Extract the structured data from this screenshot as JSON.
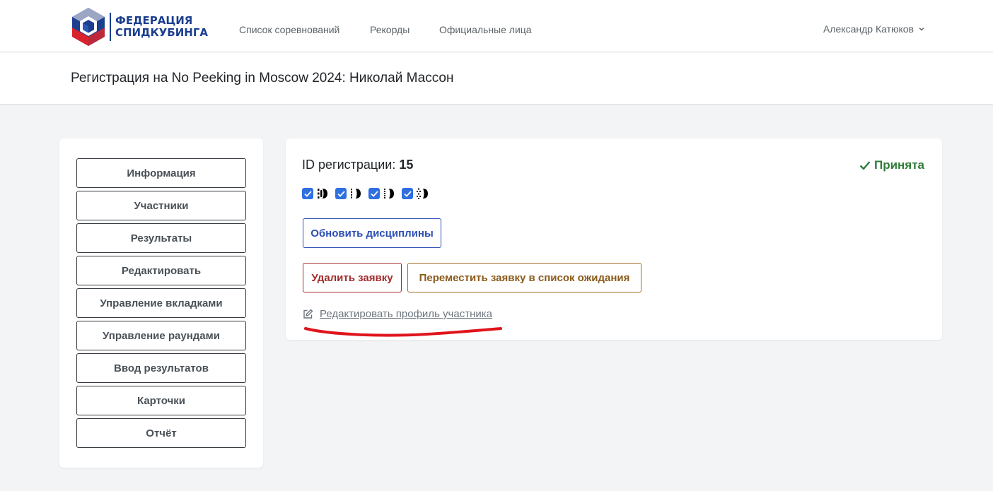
{
  "nav": {
    "logo_line1": "ФЕДЕРАЦИЯ",
    "logo_line2": "СПИДКУБИНГА",
    "links": [
      "Список соревнований",
      "Рекорды",
      "Официальные лица"
    ],
    "user": "Александр Катюков"
  },
  "page": {
    "title": "Регистрация на No Peeking in Moscow 2024: Николай Массон"
  },
  "sidebar": {
    "items": [
      "Информация",
      "Участники",
      "Результаты",
      "Редактировать",
      "Управление вкладками",
      "Управление раундами",
      "Ввод результатов",
      "Карточки",
      "Отчёт"
    ]
  },
  "registration": {
    "id_label": "ID регистрации:",
    "id_value": "15",
    "status": "Принята",
    "events": [
      "event-icon-1",
      "event-icon-2",
      "event-icon-3",
      "event-icon-4"
    ],
    "update_button": "Обновить дисциплины",
    "delete_button": "Удалить заявку",
    "move_button": "Переместить заявку в список ожидания",
    "edit_profile_link": "Редактировать профиль участника"
  },
  "colors": {
    "brand_blue": "#1b3f8f",
    "accepted_green": "#2f7d3a",
    "delete_red": "#a12b2b",
    "waitlist_orange": "#a46a1e",
    "annotation_red": "#e0141c"
  }
}
